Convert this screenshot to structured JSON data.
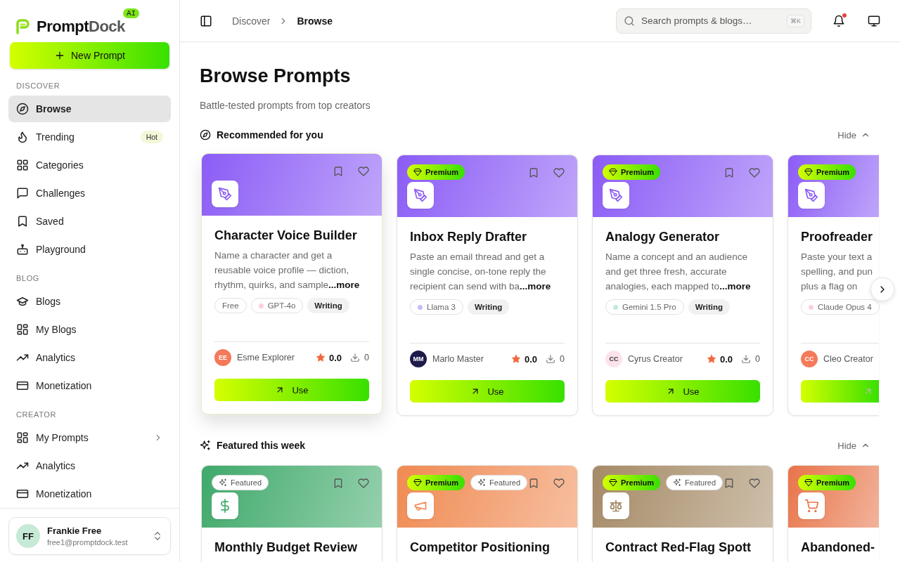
{
  "brand": {
    "name_dark": "Prompt",
    "name_light": "Dock",
    "badge": "AI"
  },
  "new_prompt_button": "New Prompt",
  "sidebar": {
    "sections": [
      {
        "label": "DISCOVER",
        "items": [
          {
            "label": "Browse",
            "selected": true,
            "expandable": false
          },
          {
            "label": "Trending",
            "selected": false,
            "expandable": false,
            "badge": "Hot"
          },
          {
            "label": "Categories",
            "selected": false,
            "expandable": false
          },
          {
            "label": "Challenges",
            "selected": false,
            "expandable": false
          },
          {
            "label": "Saved",
            "selected": false,
            "expandable": false
          },
          {
            "label": "Playground",
            "selected": false,
            "expandable": false
          }
        ]
      },
      {
        "label": "BLOG",
        "items": [
          {
            "label": "Blogs",
            "selected": false,
            "expandable": false
          },
          {
            "label": "My Blogs",
            "selected": false,
            "expandable": false
          },
          {
            "label": "Analytics",
            "selected": false,
            "expandable": false
          },
          {
            "label": "Monetization",
            "selected": false,
            "expandable": false
          }
        ]
      },
      {
        "label": "CREATOR",
        "items": [
          {
            "label": "My Prompts",
            "selected": false,
            "expandable": true
          },
          {
            "label": "Analytics",
            "selected": false,
            "expandable": false
          },
          {
            "label": "Monetization",
            "selected": false,
            "expandable": false
          }
        ]
      }
    ]
  },
  "user": {
    "initials": "FF",
    "name": "Frankie Free",
    "email": "free1@promptdock.test"
  },
  "header": {
    "breadcrumb": [
      "Discover",
      "Browse"
    ],
    "search_placeholder": "Search prompts & blogs…",
    "shortcut": "⌘K",
    "notification": true
  },
  "page": {
    "title": "Browse Prompts",
    "subtitle": "Battle-tested prompts from top creators"
  },
  "sections": [
    {
      "title": "Recommended for you",
      "hide_label": "Hide",
      "cards": [
        {
          "kind": "full",
          "highlighted": true,
          "color": "#8b5cf6",
          "title": "Character Voice Builder",
          "desc_lines": [
            "Name a character and get a",
            "reusable voice profile — diction,",
            "rhythm, quirks, and sample"
          ],
          "more": "...more",
          "tags": [
            {
              "kind": "plain",
              "label": "Free"
            },
            {
              "kind": "model",
              "label": "GPT-4o",
              "color": "#fbcfdc"
            },
            {
              "kind": "category",
              "label": "Writing"
            }
          ],
          "author": {
            "initials": "EE",
            "name": "Esme Explorer",
            "color": "#f47a5a"
          },
          "rating": "0.0",
          "downloads": "0",
          "use_label": "Use"
        },
        {
          "kind": "full",
          "highlighted": false,
          "color": "#8b5cf6",
          "badges": [
            {
              "kind": "premium",
              "label": "Premium"
            }
          ],
          "title": "Inbox Reply Drafter",
          "desc_lines": [
            "Paste an email thread and get a",
            "single concise, on-tone reply the",
            "recipient can send with ba"
          ],
          "more": "...more",
          "tags": [
            {
              "kind": "model",
              "label": "Llama 3",
              "color": "#c9bafc"
            },
            {
              "kind": "category",
              "label": "Writing"
            }
          ],
          "author": {
            "initials": "MM",
            "name": "Marlo Master",
            "color": "#1e1b4b"
          },
          "rating": "0.0",
          "downloads": "0",
          "use_label": "Use"
        },
        {
          "kind": "full",
          "highlighted": false,
          "color": "#8b5cf6",
          "badges": [
            {
              "kind": "premium",
              "label": "Premium"
            }
          ],
          "title": "Analogy Generator",
          "desc_lines": [
            "Name a concept and an audience",
            "and get three fresh, accurate",
            "analogies, each mapped to"
          ],
          "more": "...more",
          "tags": [
            {
              "kind": "model",
              "label": "Gemini 1.5 Pro",
              "color": "#c2ebd8"
            },
            {
              "kind": "category",
              "label": "Writing"
            }
          ],
          "author": {
            "initials": "CC",
            "name": "Cyrus Creator",
            "color": "#fde2ea"
          },
          "rating": "0.0",
          "downloads": "0",
          "use_label": "Use"
        },
        {
          "kind": "partial",
          "highlighted": false,
          "color": "#8b5cf6",
          "badges": [
            {
              "kind": "premium",
              "label": "Premium"
            }
          ],
          "title": "Proofreader",
          "desc_lines": [
            "Paste your text a",
            "spelling, and pun",
            "plus a flag on"
          ],
          "tags": [
            {
              "kind": "model",
              "label": "Claude Opus 4",
              "color": "#fbcfdc"
            }
          ],
          "author": {
            "initials": "CC",
            "name": "Cleo Creator",
            "color": "#f47a5a"
          }
        }
      ]
    },
    {
      "title": "Featured this week",
      "hide_label": "Hide",
      "cards": [
        {
          "kind": "full",
          "highlighted": false,
          "color": "#3fa96a",
          "badges": [
            {
              "kind": "featured",
              "label": "Featured"
            }
          ],
          "title": "Monthly Budget Review"
        },
        {
          "kind": "full",
          "highlighted": false,
          "color": "#f08a52",
          "badges": [
            {
              "kind": "premium",
              "label": "Premium"
            },
            {
              "kind": "featured",
              "label": "Featured"
            }
          ],
          "title": "Competitor Positioning"
        },
        {
          "kind": "full",
          "highlighted": false,
          "color": "#a58a66",
          "badges": [
            {
              "kind": "premium",
              "label": "Premium"
            },
            {
              "kind": "featured",
              "label": "Featured"
            }
          ],
          "title": "Contract Red-Flag Spott"
        },
        {
          "kind": "partial",
          "highlighted": false,
          "color": "#e8744a",
          "badges": [
            {
              "kind": "premium",
              "label": "Premium"
            }
          ],
          "title": "Abandoned-"
        }
      ]
    }
  ]
}
